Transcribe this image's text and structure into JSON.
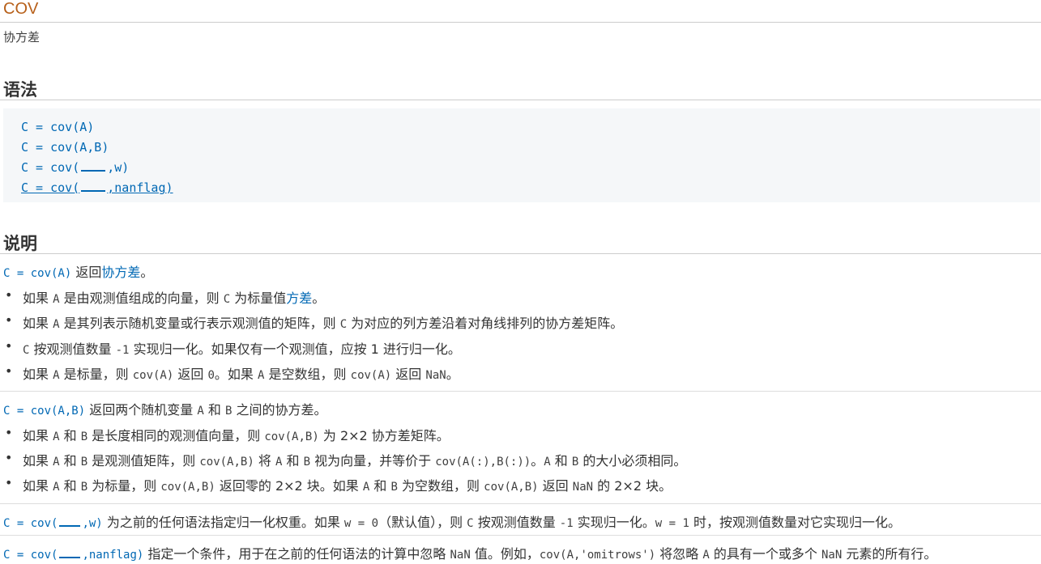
{
  "title": "COV",
  "subtitle": "协方差",
  "syntax_heading": "语法",
  "syntax": [
    {
      "pre": "C = cov(A)",
      "post": ""
    },
    {
      "pre": "C = cov(A,B)",
      "post": ""
    },
    {
      "pre": "C = cov(",
      "post": ",w)"
    },
    {
      "pre": "C = cov(",
      "post": ",nanflag)"
    }
  ],
  "description_heading": "说明",
  "desc1": {
    "code": "C = cov(A)",
    "t1": " 返回",
    "link": "协方差",
    "t2": "。"
  },
  "bullets1": [
    {
      "a": "如果 ",
      "c1": "A",
      "b": " 是由观测值组成的向量，则 ",
      "c2": "C",
      "c": " 为标量值",
      "link": "方差",
      "d": "。"
    },
    {
      "a": "如果 ",
      "c1": "A",
      "b": " 是其列表示随机变量或行表示观测值的矩阵，则 ",
      "c2": "C",
      "c": " 为对应的列方差沿着对角线排列的协方差矩阵。"
    },
    {
      "c1": "C",
      "a": " 按观测值数量 ",
      "c2": "-1",
      "b": " 实现归一化。如果仅有一个观测值，应按 1 进行归一化。"
    },
    {
      "a": "如果 ",
      "c1": "A",
      "b": " 是标量，则 ",
      "c2": "cov(A)",
      "c": " 返回 ",
      "c3": "0",
      "d": "。如果 ",
      "c4": "A",
      "e": " 是空数组，则 ",
      "c5": "cov(A)",
      "f": " 返回 ",
      "c6": "NaN",
      "g": "。"
    }
  ],
  "desc2": {
    "code": "C = cov(A,B)",
    "t1": " 返回两个随机变量 ",
    "c1": "A",
    "t2": " 和 ",
    "c2": "B",
    "t3": " 之间的协方差。"
  },
  "bullets2": [
    {
      "a": "如果 ",
      "c1": "A",
      "b": " 和 ",
      "c2": "B",
      "c": " 是长度相同的观测值向量，则 ",
      "c3": "cov(A,B)",
      "d": " 为 2×2 协方差矩阵。"
    },
    {
      "a": "如果 ",
      "c1": "A",
      "b": " 和 ",
      "c2": "B",
      "c": " 是观测值矩阵，则 ",
      "c3": "cov(A,B)",
      "d": " 将 ",
      "c4": "A",
      "e": " 和 ",
      "c5": "B",
      "f": " 视为向量，并等价于 ",
      "c6": "cov(A(:),B(:))",
      "g": "。",
      "c7": "A",
      "h": " 和 ",
      "c8": "B",
      "i": " 的大小必须相同。"
    },
    {
      "a": "如果 ",
      "c1": "A",
      "b": " 和 ",
      "c2": "B",
      "c": " 为标量，则 ",
      "c3": "cov(A,B)",
      "d": " 返回零的 2×2 块。如果 ",
      "c4": "A",
      "e": " 和 ",
      "c5": "B",
      "f": " 为空数组，则 ",
      "c6": "cov(A,B)",
      "g": " 返回 ",
      "c7": "NaN",
      "h": " 的 2×2 块。"
    }
  ],
  "desc3": {
    "pre": "C = cov(",
    "post": ",w)",
    "t1": " 为之前的任何语法指定归一化权重。如果 ",
    "c1": "w = 0",
    "t2": "（默认值），则 ",
    "c2": "C",
    "t3": " 按观测值数量 ",
    "c3": "-1",
    "t4": " 实现归一化。",
    "c4": "w = 1",
    "t5": " 时，按观测值数量对它实现归一化。"
  },
  "desc4": {
    "pre": "C = cov(",
    "post": ",nanflag)",
    "t1": " 指定一个条件，用于在之前的任何语法的计算中忽略 ",
    "c1": "NaN",
    "t2": " 值。例如，",
    "c2": "cov(A,'omitrows')",
    "t3": " 将忽略 ",
    "c3": "A",
    "t4": " 的具有一个或多个 ",
    "c4": "NaN",
    "t5": " 元素的所有行。"
  },
  "colors": {
    "title": "#b7601a",
    "link": "#0068b4",
    "syntax_bg": "#f5f7f9"
  }
}
